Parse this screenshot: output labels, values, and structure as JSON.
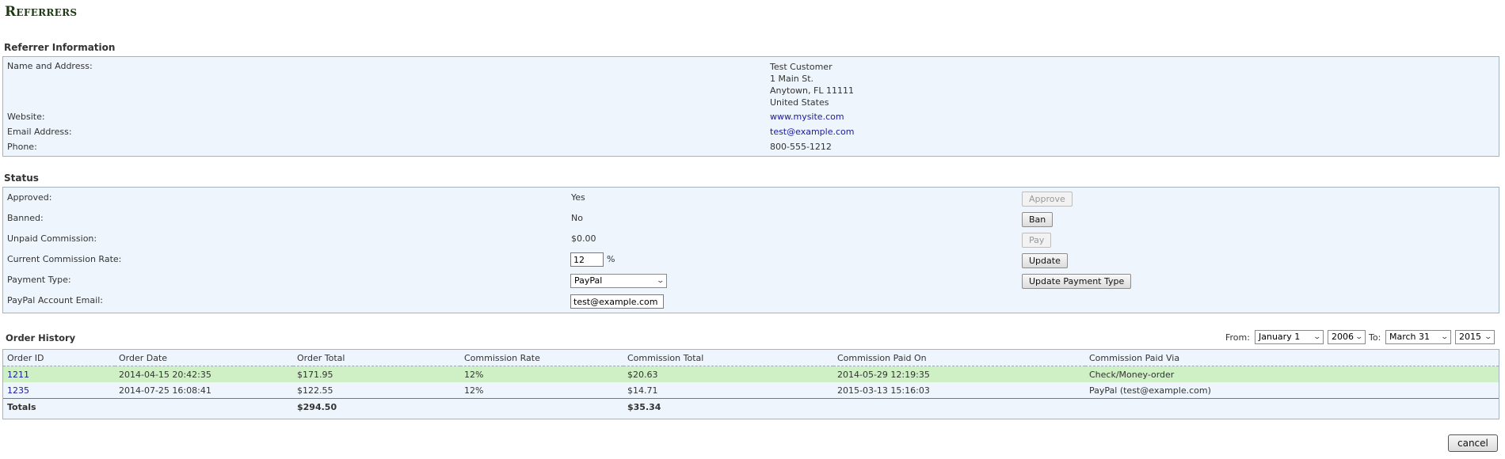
{
  "page": {
    "title": "Referrers"
  },
  "referrer": {
    "section_title": "Referrer Information",
    "name_label": "Name and Address:",
    "name": "Test Customer",
    "address1": "1 Main St.",
    "address2": "Anytown, FL 11111",
    "country": "United States",
    "website_label": "Website:",
    "website": "www.mysite.com",
    "email_label": "Email Address:",
    "email": "test@example.com",
    "phone_label": "Phone:",
    "phone": "800-555-1212"
  },
  "status": {
    "section_title": "Status",
    "approved_label": "Approved:",
    "approved": "Yes",
    "approve_button": "Approve",
    "banned_label": "Banned:",
    "banned": "No",
    "ban_button": "Ban",
    "unpaid_label": "Unpaid Commission:",
    "unpaid": "$0.00",
    "pay_button": "Pay",
    "rate_label": "Current Commission Rate:",
    "rate": "12",
    "rate_unit": "%",
    "update_button": "Update",
    "payment_type_label": "Payment Type:",
    "payment_type": "PayPal",
    "update_payment_button": "Update Payment Type",
    "paypal_email_label": "PayPal Account Email:",
    "paypal_email": "test@example.com"
  },
  "history": {
    "section_title": "Order History",
    "from_label": "From:",
    "from_date": "January 1",
    "from_year": "2006",
    "to_label": "To:",
    "to_date": "March 31",
    "to_year": "2015",
    "columns": [
      "Order ID",
      "Order Date",
      "Order Total",
      "Commission Rate",
      "Commission Total",
      "Commission Paid On",
      "Commission Paid Via"
    ],
    "rows": [
      {
        "id": "1211",
        "date": "2014-04-15 20:42:35",
        "total": "$171.95",
        "rate": "12%",
        "commission": "$20.63",
        "paid_on": "2014-05-29 12:19:35",
        "paid_via": "Check/Money-order"
      },
      {
        "id": "1235",
        "date": "2014-07-25 16:08:41",
        "total": "$122.55",
        "rate": "12%",
        "commission": "$14.71",
        "paid_on": "2015-03-13 15:16:03",
        "paid_via": "PayPal (test@example.com)"
      }
    ],
    "totals_label": "Totals",
    "totals_order": "$294.50",
    "totals_commission": "$35.34"
  },
  "footer": {
    "cancel_button": "cancel"
  },
  "colors": {
    "title": "#1d3a12",
    "panel_bg": "#eef5fc",
    "panel_border": "#9fb5c4",
    "row_highlight": "#cfefc5",
    "link": "#1a1a9c"
  }
}
